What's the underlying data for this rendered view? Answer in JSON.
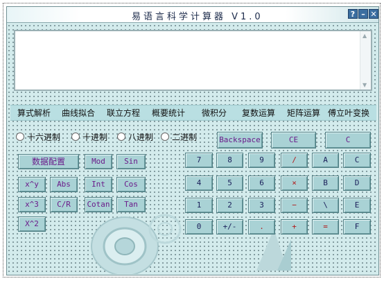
{
  "window": {
    "title": "易语言科学计算器 V1.0",
    "help_label": "?",
    "minimize_label": "–",
    "close_label": "✕"
  },
  "display": {
    "value": "",
    "scroll_up": "▲",
    "scroll_down": "▼"
  },
  "menu": {
    "items": [
      "算式解析",
      "曲线拟合",
      "联立方程",
      "概要统计",
      "微积分",
      "复数运算",
      "矩阵运算",
      "傅立叶变换"
    ]
  },
  "base": {
    "options": [
      "十六进制",
      "十进制",
      "八进制",
      "二进制"
    ],
    "selected": null
  },
  "top_buttons": {
    "backspace": "Backspace",
    "ce": "CE",
    "c": "C"
  },
  "function_buttons": {
    "data_config": "数据配置",
    "mod": "Mod",
    "sin": "Sin",
    "xy": "x^y",
    "abs": "Abs",
    "int": "Int",
    "cos": "Cos",
    "x3": "x^3",
    "cr": "C/R",
    "cotan": "Cotan",
    "tan": "Tan",
    "x2": "X^2"
  },
  "keypad": {
    "rows": [
      [
        "7",
        "8",
        "9",
        "/",
        "A",
        "C"
      ],
      [
        "4",
        "5",
        "6",
        "×",
        "B",
        "D"
      ],
      [
        "1",
        "2",
        "3",
        "−",
        "\\",
        "E"
      ],
      [
        "0",
        "+/-",
        ".",
        "+",
        "=",
        "F"
      ]
    ]
  }
}
